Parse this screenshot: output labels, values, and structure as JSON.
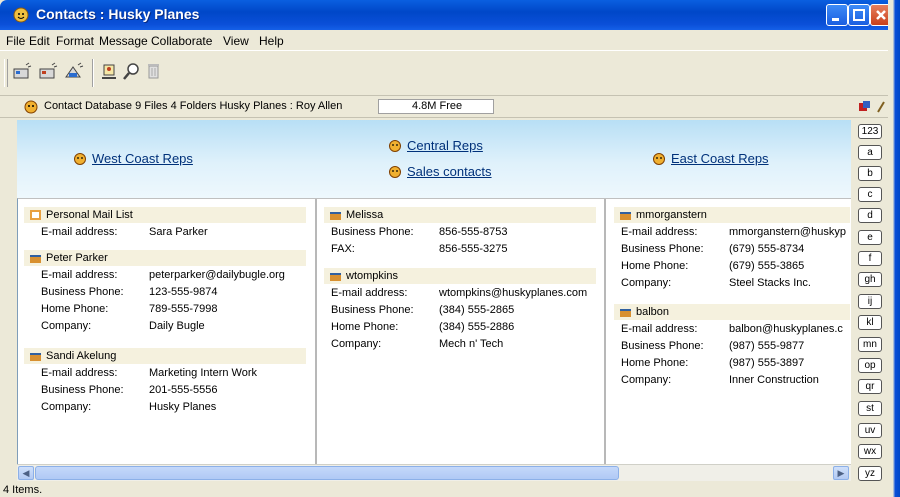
{
  "window": {
    "title": "Contacts : Husky Planes"
  },
  "menu": [
    "File",
    "Edit",
    "Format",
    "Message",
    "Collaborate",
    "View",
    "Help"
  ],
  "toolbar": {
    "icons": [
      "new-contact-icon",
      "new-group-icon",
      "new-mail-list-icon",
      "properties-icon",
      "find-icon",
      "delete-icon"
    ]
  },
  "infobar": {
    "text": "Contact Database  9 Files  4 Folders  Husky Planes : Roy Allen",
    "free": "4.8M Free"
  },
  "groups": {
    "west": "West Coast Reps",
    "central": "Central Reps",
    "sales": "Sales contacts",
    "east": "East Coast Reps"
  },
  "contacts": {
    "col1": [
      {
        "name": "Personal Mail List",
        "fields": [
          [
            "E-mail address:",
            "Sara Parker"
          ]
        ]
      },
      {
        "name": "Peter Parker",
        "fields": [
          [
            "E-mail address:",
            "peterparker@dailybugle.org"
          ],
          [
            "Business Phone:",
            "123-555-9874"
          ],
          [
            "Home Phone:",
            "789-555-7998"
          ],
          [
            "Company:",
            "Daily Bugle"
          ]
        ]
      },
      {
        "name": "Sandi Akelung",
        "fields": [
          [
            "E-mail address:",
            "Marketing Intern Work"
          ],
          [
            "Business Phone:",
            "201-555-5556"
          ],
          [
            "Company:",
            "Husky Planes"
          ]
        ]
      }
    ],
    "col2": [
      {
        "name": "Melissa",
        "fields": [
          [
            "Business Phone:",
            "856-555-8753"
          ],
          [
            "FAX:",
            "856-555-3275"
          ]
        ]
      },
      {
        "name": "wtompkins",
        "fields": [
          [
            "E-mail address:",
            "wtompkins@huskyplanes.com"
          ],
          [
            "Business Phone:",
            "(384) 555-2865"
          ],
          [
            "Home Phone:",
            "(384) 555-2886"
          ],
          [
            "Company:",
            "Mech n' Tech"
          ]
        ]
      }
    ],
    "col3": [
      {
        "name": "mmorganstern",
        "fields": [
          [
            "E-mail address:",
            "mmorganstern@huskyp"
          ],
          [
            "Business Phone:",
            "(679) 555-8734"
          ],
          [
            "Home Phone:",
            "(679) 555-3865"
          ],
          [
            "Company:",
            "Steel Stacks Inc."
          ]
        ]
      },
      {
        "name": "balbon",
        "fields": [
          [
            "E-mail address:",
            "balbon@huskyplanes.c"
          ],
          [
            "Business Phone:",
            "(987) 555-9877"
          ],
          [
            "Home Phone:",
            "(987) 555-3897"
          ],
          [
            "Company:",
            "Inner Construction"
          ]
        ]
      }
    ]
  },
  "alpha_tabs": [
    "123",
    "a",
    "b",
    "c",
    "d",
    "e",
    "f",
    "gh",
    "ij",
    "kl",
    "mn",
    "op",
    "qr",
    "st",
    "uv",
    "wx",
    "yz"
  ],
  "status": "4 Items."
}
